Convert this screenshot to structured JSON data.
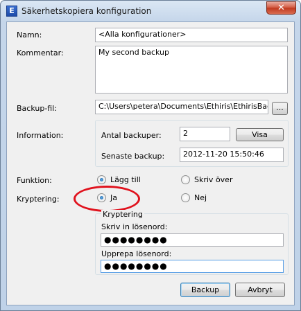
{
  "window": {
    "title": "Säkerhetskopiera konfiguration",
    "icon_letter": "E",
    "close_glyph": "✕"
  },
  "form": {
    "name_label": "Namn:",
    "name_value": "<Alla konfigurationer>",
    "comment_label": "Kommentar:",
    "comment_value": "My second backup",
    "backup_file_label": "Backup-fil:",
    "backup_file_value": "C:\\Users\\petera\\Documents\\Ethiris\\EthirisBacku",
    "browse_label": "...",
    "information_label": "Information:",
    "backup_count_label": "Antal backuper:",
    "backup_count_value": "2",
    "show_label": "Visa",
    "last_backup_label": "Senaste backup:",
    "last_backup_value": "2012-11-20 15:50:46",
    "function_label": "Funktion:",
    "function_options": [
      "Lägg till",
      "Skriv över"
    ],
    "function_selected": 0,
    "encryption_label": "Kryptering:",
    "encryption_options": [
      "Ja",
      "Nej"
    ],
    "encryption_selected": 0,
    "encryption_group_title": "Kryptering",
    "password_label": "Skriv in lösenord:",
    "password_value": "●●●●●●●●",
    "repeat_password_label": "Upprepa lösenord:",
    "repeat_password_value": "●●●●●●●●"
  },
  "buttons": {
    "backup": "Backup",
    "cancel": "Avbryt"
  },
  "colors": {
    "highlight_ellipse": "#e0121d",
    "default_button_border": "#3c7fb1"
  }
}
